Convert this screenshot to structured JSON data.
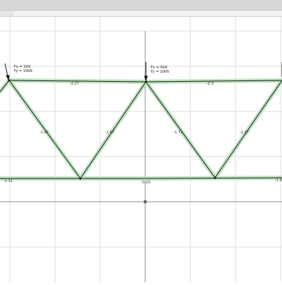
{
  "loads": {
    "left": {
      "fx": "Fx = 2kN",
      "fy": "Fy = 10kN"
    },
    "middle": {
      "fx": "Fx = 0kN",
      "fy": "Fy = 10kN"
    }
  },
  "forces": {
    "top_left": "-2.27",
    "top_right": "-2.3",
    "diag_1": "-1.97",
    "diag_2": "-1.97",
    "diag_3": "-1.71",
    "diag_4": "-2.17",
    "bottom_left": "-1.31",
    "bottom_mid": "-0.29",
    "bottom_right": "-1.6"
  },
  "colors": {
    "member_highlight": "#bfe3bf",
    "member_line": "#1a1a1a",
    "grid": "#dddddd",
    "axis": "#555555"
  }
}
